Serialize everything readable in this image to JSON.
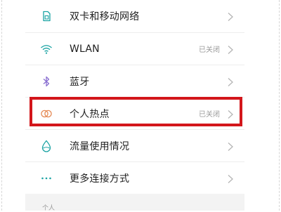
{
  "settings": {
    "items": [
      {
        "label": "双卡和移动网络",
        "status": "",
        "icon": "sim-card-icon"
      },
      {
        "label": "WLAN",
        "status": "已关闭",
        "icon": "wifi-icon"
      },
      {
        "label": "蓝牙",
        "status": "",
        "icon": "bluetooth-icon"
      },
      {
        "label": "个人热点",
        "status": "已关闭",
        "icon": "hotspot-icon"
      },
      {
        "label": "流量使用情况",
        "status": "",
        "icon": "data-usage-icon"
      },
      {
        "label": "更多连接方式",
        "status": "",
        "icon": "more-icon"
      }
    ],
    "section_title": "个人"
  },
  "colors": {
    "icon_teal": "#1aa3a3",
    "hotspot_orange": "#e58a55",
    "highlight_red": "#d3161b"
  }
}
